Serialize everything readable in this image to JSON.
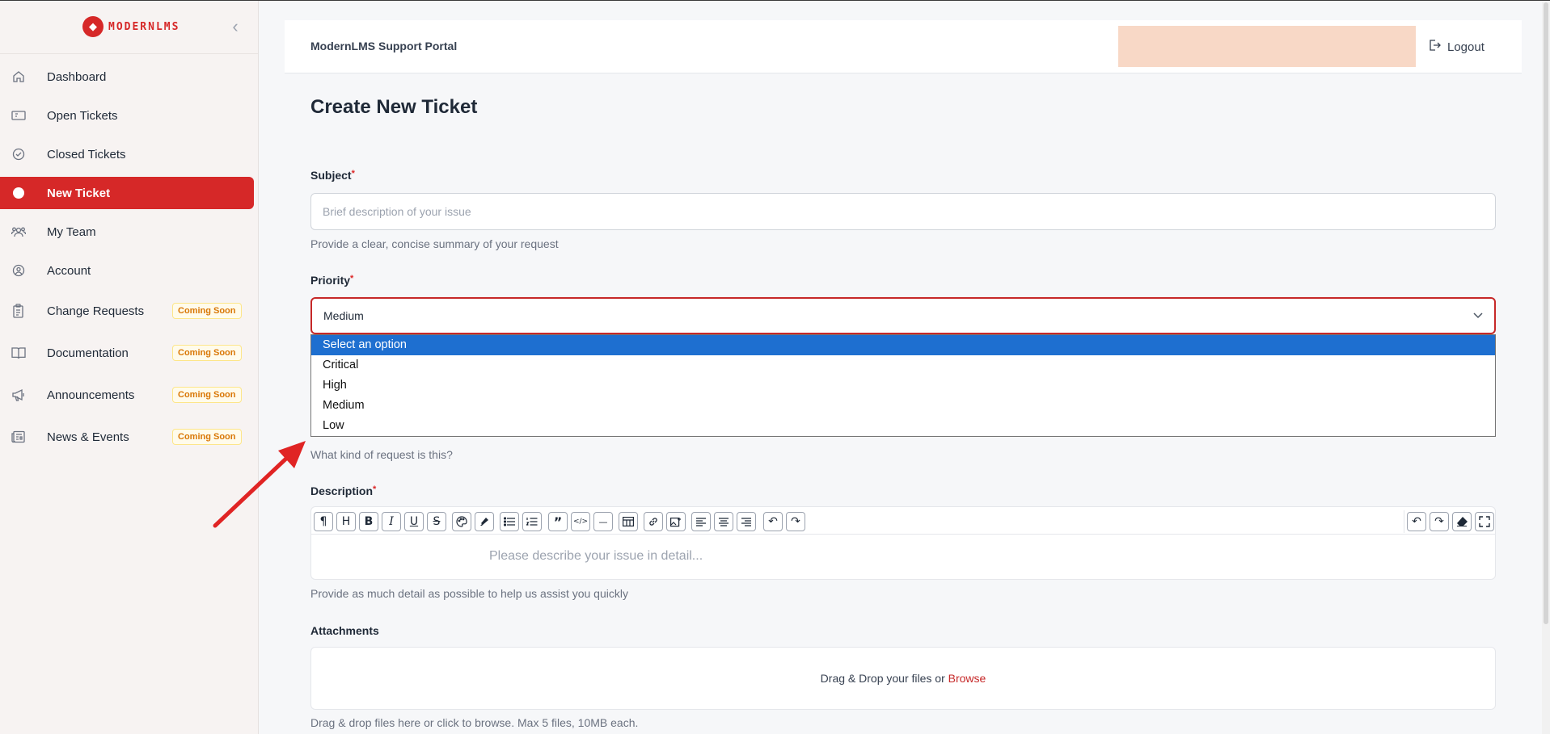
{
  "app": {
    "logo_text": "MODERNLMS",
    "portal_title": "ModernLMS Support Portal",
    "logout_label": "Logout"
  },
  "sidebar": {
    "items": [
      {
        "label": "Dashboard",
        "icon": "home-icon"
      },
      {
        "label": "Open Tickets",
        "icon": "ticket-icon"
      },
      {
        "label": "Closed Tickets",
        "icon": "check-circle-icon"
      },
      {
        "label": "New Ticket",
        "icon": "plus-circle-icon",
        "active": true
      },
      {
        "label": "My Team",
        "icon": "team-icon"
      },
      {
        "label": "Account",
        "icon": "user-circle-icon"
      },
      {
        "label": "Change Requests",
        "icon": "clipboard-icon",
        "badge": "Coming Soon"
      },
      {
        "label": "Documentation",
        "icon": "book-icon",
        "badge": "Coming Soon"
      },
      {
        "label": "Announcements",
        "icon": "megaphone-icon",
        "badge": "Coming Soon"
      },
      {
        "label": "News & Events",
        "icon": "newspaper-icon",
        "badge": "Coming Soon"
      }
    ]
  },
  "form": {
    "title": "Create New Ticket",
    "subject": {
      "label": "Subject",
      "placeholder": "Brief description of your issue",
      "help": "Provide a clear, concise summary of your request"
    },
    "priority": {
      "label": "Priority",
      "value": "Medium",
      "options": [
        "Select an option",
        "Critical",
        "High",
        "Medium",
        "Low"
      ],
      "highlighted": "Select an option"
    },
    "type_help": "What kind of request is this?",
    "description": {
      "label": "Description",
      "placeholder": "Please describe your issue in detail...",
      "help": "Provide as much detail as possible to help us assist you quickly"
    },
    "attachments": {
      "label": "Attachments",
      "drop_text": "Drag & Drop your files or ",
      "browse": "Browse",
      "help": "Drag & drop files here or click to browse. Max 5 files, 10MB each."
    }
  },
  "colors": {
    "accent": "#d62828",
    "highlight": "#1e6fd0",
    "badge_text": "#d97706"
  }
}
